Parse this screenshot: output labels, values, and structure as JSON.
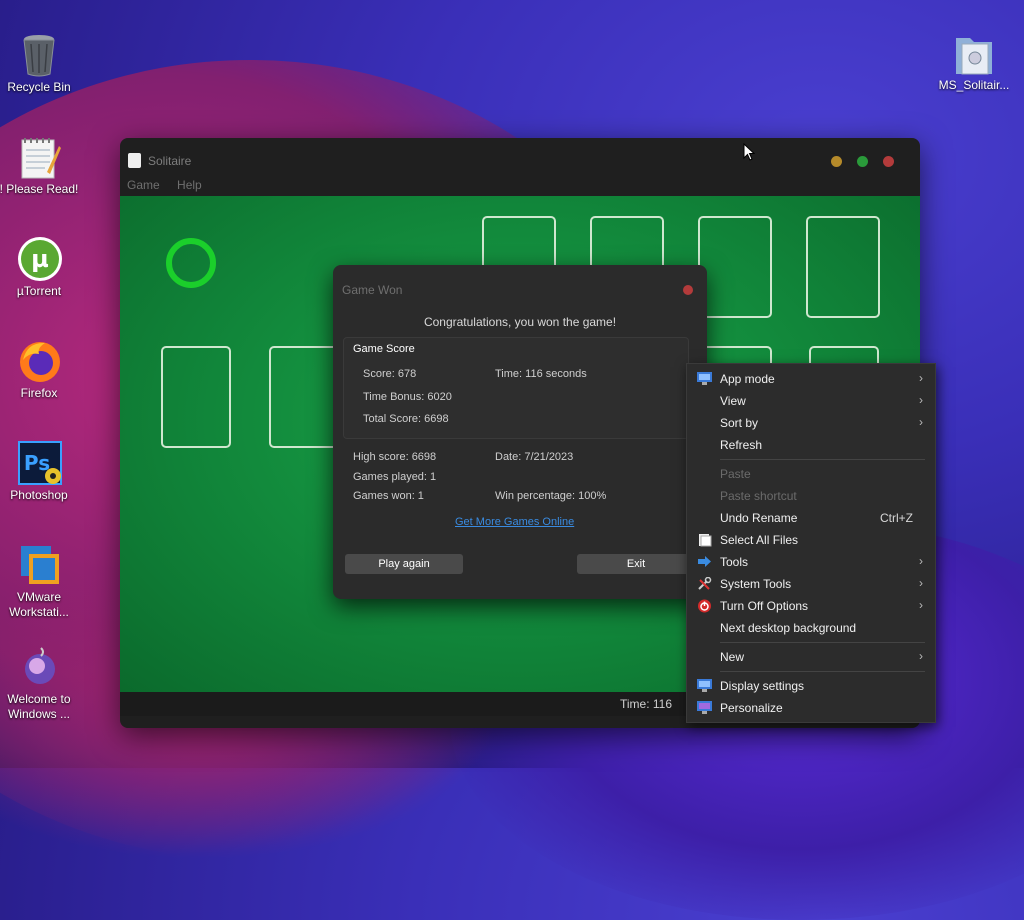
{
  "desktop": {
    "icons": [
      {
        "label": "Recycle Bin"
      },
      {
        "label": "! Please Read!"
      },
      {
        "label": "µTorrent"
      },
      {
        "label": "Firefox"
      },
      {
        "label": "Photoshop"
      },
      {
        "label": "VMware Workstati..."
      },
      {
        "label": "Welcome to Windows ..."
      },
      {
        "label": "MS_Solitair..."
      }
    ]
  },
  "window": {
    "title": "Solitaire",
    "menu": [
      "Game",
      "Help"
    ],
    "controls": {
      "minimize": "#b58a2a",
      "maximize": "#2a9a3a",
      "close": "#b33b3b"
    },
    "status": {
      "time": "Time:  116"
    }
  },
  "dialog": {
    "title": "Game Won",
    "congrats": "Congratulations, you won the game!",
    "game_score_heading": "Game Score",
    "score": "Score: 678",
    "time": "Time:  116 seconds",
    "time_bonus": "Time Bonus: 6020",
    "total_score": "Total Score: 6698",
    "high_score": "High score: 6698",
    "date": "Date: 7/21/2023",
    "games_played": "Games played: 1",
    "games_won": "Games won: 1",
    "win_percentage": "Win percentage: 100%",
    "link": "Get More Games Online",
    "play_again": "Play again",
    "exit": "Exit"
  },
  "context_menu": {
    "items": [
      {
        "label": "App mode",
        "icon": "app-mode-icon",
        "submenu": true
      },
      {
        "label": "View",
        "submenu": true
      },
      {
        "label": "Sort by",
        "submenu": true
      },
      {
        "label": "Refresh"
      },
      {
        "label": "Paste",
        "disabled": true
      },
      {
        "label": "Paste shortcut",
        "disabled": true
      },
      {
        "label": "Undo Rename",
        "shortcut": "Ctrl+Z"
      },
      {
        "label": "Select All Files",
        "icon": "select-all-icon"
      },
      {
        "label": "Tools",
        "icon": "tools-arrow-icon",
        "submenu": true
      },
      {
        "label": "System Tools",
        "icon": "system-tools-icon",
        "submenu": true
      },
      {
        "label": "Turn Off Options",
        "icon": "power-icon",
        "submenu": true
      },
      {
        "label": "Next desktop background"
      },
      {
        "label": "New",
        "submenu": true
      },
      {
        "label": "Display settings",
        "icon": "display-icon"
      },
      {
        "label": "Personalize",
        "icon": "personalize-icon"
      }
    ]
  }
}
